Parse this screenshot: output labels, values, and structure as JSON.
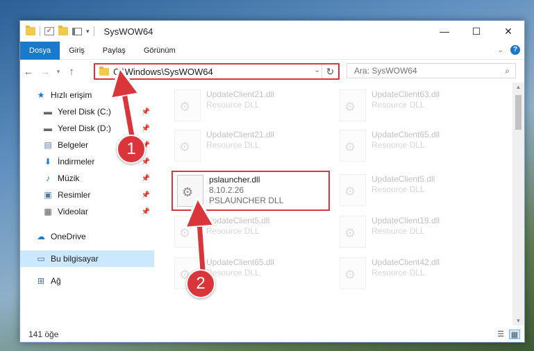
{
  "window": {
    "title": "SysWOW64"
  },
  "window_controls": {
    "minimize": "—",
    "maximize": "☐",
    "close": "✕"
  },
  "ribbon": {
    "tabs": [
      "Dosya",
      "Giriş",
      "Paylaş",
      "Görünüm"
    ]
  },
  "address": {
    "path": "C:\\Windows\\SysWOW64"
  },
  "search": {
    "placeholder": "Ara: SysWOW64"
  },
  "sidebar": {
    "quick_access": "Hızlı erişim",
    "items": [
      {
        "label": "Yerel Disk (C:)",
        "pinned": true
      },
      {
        "label": "Yerel Disk (D:)",
        "pinned": true
      },
      {
        "label": "Belgeler",
        "pinned": true
      },
      {
        "label": "İndirmeler",
        "pinned": true
      },
      {
        "label": "Müzik",
        "pinned": true
      },
      {
        "label": "Resimler",
        "pinned": true
      },
      {
        "label": "Videolar",
        "pinned": true
      }
    ],
    "onedrive": "OneDrive",
    "this_pc": "Bu bilgisayar",
    "network": "Ağ"
  },
  "files": {
    "left": [
      {
        "name": "UpdateClient21.dll",
        "desc": "Resource DLL"
      },
      {
        "name": "UpdateClient21.dll",
        "desc": "Resource DLL"
      },
      {
        "name": "pslauncher.dll",
        "version": "8.10.2.26",
        "desc": "PSLAUNCHER DLL"
      },
      {
        "name": "UpdateClient5.dll",
        "desc": "Resource DLL"
      },
      {
        "name": "UpdateClient65.dll",
        "desc": "Resource DLL"
      }
    ],
    "right": [
      {
        "name": "UpdateClient63.dll",
        "desc": "Resource DLL"
      },
      {
        "name": "UpdateClient65.dll",
        "desc": "Resource DLL"
      },
      {
        "name": "UpdateClient5.dll",
        "desc": "Resource DLL"
      },
      {
        "name": "UpdateClient19.dll",
        "desc": "Resource DLL"
      },
      {
        "name": "UpdateClient42.dll",
        "desc": "Resource DLL"
      }
    ]
  },
  "status": {
    "count": "141 öğe"
  },
  "callouts": [
    "1",
    "2"
  ],
  "colors": {
    "accent": "#1979ca",
    "highlight": "#d9353a",
    "selected": "#cce8ff"
  }
}
